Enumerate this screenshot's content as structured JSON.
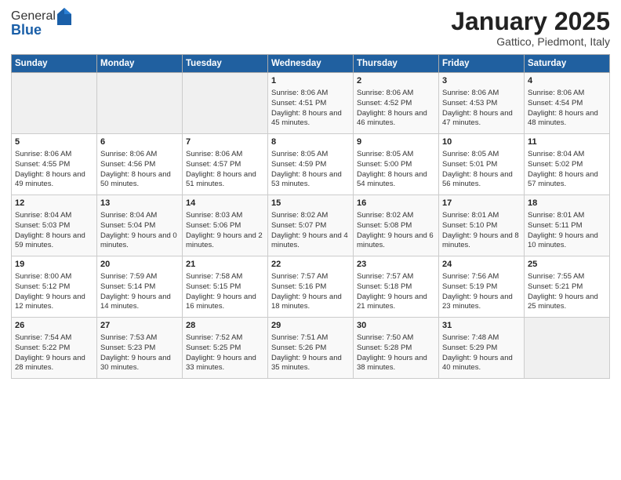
{
  "header": {
    "logo_general": "General",
    "logo_blue": "Blue",
    "title": "January 2025",
    "subtitle": "Gattico, Piedmont, Italy"
  },
  "days_of_week": [
    "Sunday",
    "Monday",
    "Tuesday",
    "Wednesday",
    "Thursday",
    "Friday",
    "Saturday"
  ],
  "weeks": [
    [
      {
        "day": "",
        "sunrise": "",
        "sunset": "",
        "daylight": ""
      },
      {
        "day": "",
        "sunrise": "",
        "sunset": "",
        "daylight": ""
      },
      {
        "day": "",
        "sunrise": "",
        "sunset": "",
        "daylight": ""
      },
      {
        "day": "1",
        "sunrise": "Sunrise: 8:06 AM",
        "sunset": "Sunset: 4:51 PM",
        "daylight": "Daylight: 8 hours and 45 minutes."
      },
      {
        "day": "2",
        "sunrise": "Sunrise: 8:06 AM",
        "sunset": "Sunset: 4:52 PM",
        "daylight": "Daylight: 8 hours and 46 minutes."
      },
      {
        "day": "3",
        "sunrise": "Sunrise: 8:06 AM",
        "sunset": "Sunset: 4:53 PM",
        "daylight": "Daylight: 8 hours and 47 minutes."
      },
      {
        "day": "4",
        "sunrise": "Sunrise: 8:06 AM",
        "sunset": "Sunset: 4:54 PM",
        "daylight": "Daylight: 8 hours and 48 minutes."
      }
    ],
    [
      {
        "day": "5",
        "sunrise": "Sunrise: 8:06 AM",
        "sunset": "Sunset: 4:55 PM",
        "daylight": "Daylight: 8 hours and 49 minutes."
      },
      {
        "day": "6",
        "sunrise": "Sunrise: 8:06 AM",
        "sunset": "Sunset: 4:56 PM",
        "daylight": "Daylight: 8 hours and 50 minutes."
      },
      {
        "day": "7",
        "sunrise": "Sunrise: 8:06 AM",
        "sunset": "Sunset: 4:57 PM",
        "daylight": "Daylight: 8 hours and 51 minutes."
      },
      {
        "day": "8",
        "sunrise": "Sunrise: 8:05 AM",
        "sunset": "Sunset: 4:59 PM",
        "daylight": "Daylight: 8 hours and 53 minutes."
      },
      {
        "day": "9",
        "sunrise": "Sunrise: 8:05 AM",
        "sunset": "Sunset: 5:00 PM",
        "daylight": "Daylight: 8 hours and 54 minutes."
      },
      {
        "day": "10",
        "sunrise": "Sunrise: 8:05 AM",
        "sunset": "Sunset: 5:01 PM",
        "daylight": "Daylight: 8 hours and 56 minutes."
      },
      {
        "day": "11",
        "sunrise": "Sunrise: 8:04 AM",
        "sunset": "Sunset: 5:02 PM",
        "daylight": "Daylight: 8 hours and 57 minutes."
      }
    ],
    [
      {
        "day": "12",
        "sunrise": "Sunrise: 8:04 AM",
        "sunset": "Sunset: 5:03 PM",
        "daylight": "Daylight: 8 hours and 59 minutes."
      },
      {
        "day": "13",
        "sunrise": "Sunrise: 8:04 AM",
        "sunset": "Sunset: 5:04 PM",
        "daylight": "Daylight: 9 hours and 0 minutes."
      },
      {
        "day": "14",
        "sunrise": "Sunrise: 8:03 AM",
        "sunset": "Sunset: 5:06 PM",
        "daylight": "Daylight: 9 hours and 2 minutes."
      },
      {
        "day": "15",
        "sunrise": "Sunrise: 8:02 AM",
        "sunset": "Sunset: 5:07 PM",
        "daylight": "Daylight: 9 hours and 4 minutes."
      },
      {
        "day": "16",
        "sunrise": "Sunrise: 8:02 AM",
        "sunset": "Sunset: 5:08 PM",
        "daylight": "Daylight: 9 hours and 6 minutes."
      },
      {
        "day": "17",
        "sunrise": "Sunrise: 8:01 AM",
        "sunset": "Sunset: 5:10 PM",
        "daylight": "Daylight: 9 hours and 8 minutes."
      },
      {
        "day": "18",
        "sunrise": "Sunrise: 8:01 AM",
        "sunset": "Sunset: 5:11 PM",
        "daylight": "Daylight: 9 hours and 10 minutes."
      }
    ],
    [
      {
        "day": "19",
        "sunrise": "Sunrise: 8:00 AM",
        "sunset": "Sunset: 5:12 PM",
        "daylight": "Daylight: 9 hours and 12 minutes."
      },
      {
        "day": "20",
        "sunrise": "Sunrise: 7:59 AM",
        "sunset": "Sunset: 5:14 PM",
        "daylight": "Daylight: 9 hours and 14 minutes."
      },
      {
        "day": "21",
        "sunrise": "Sunrise: 7:58 AM",
        "sunset": "Sunset: 5:15 PM",
        "daylight": "Daylight: 9 hours and 16 minutes."
      },
      {
        "day": "22",
        "sunrise": "Sunrise: 7:57 AM",
        "sunset": "Sunset: 5:16 PM",
        "daylight": "Daylight: 9 hours and 18 minutes."
      },
      {
        "day": "23",
        "sunrise": "Sunrise: 7:57 AM",
        "sunset": "Sunset: 5:18 PM",
        "daylight": "Daylight: 9 hours and 21 minutes."
      },
      {
        "day": "24",
        "sunrise": "Sunrise: 7:56 AM",
        "sunset": "Sunset: 5:19 PM",
        "daylight": "Daylight: 9 hours and 23 minutes."
      },
      {
        "day": "25",
        "sunrise": "Sunrise: 7:55 AM",
        "sunset": "Sunset: 5:21 PM",
        "daylight": "Daylight: 9 hours and 25 minutes."
      }
    ],
    [
      {
        "day": "26",
        "sunrise": "Sunrise: 7:54 AM",
        "sunset": "Sunset: 5:22 PM",
        "daylight": "Daylight: 9 hours and 28 minutes."
      },
      {
        "day": "27",
        "sunrise": "Sunrise: 7:53 AM",
        "sunset": "Sunset: 5:23 PM",
        "daylight": "Daylight: 9 hours and 30 minutes."
      },
      {
        "day": "28",
        "sunrise": "Sunrise: 7:52 AM",
        "sunset": "Sunset: 5:25 PM",
        "daylight": "Daylight: 9 hours and 33 minutes."
      },
      {
        "day": "29",
        "sunrise": "Sunrise: 7:51 AM",
        "sunset": "Sunset: 5:26 PM",
        "daylight": "Daylight: 9 hours and 35 minutes."
      },
      {
        "day": "30",
        "sunrise": "Sunrise: 7:50 AM",
        "sunset": "Sunset: 5:28 PM",
        "daylight": "Daylight: 9 hours and 38 minutes."
      },
      {
        "day": "31",
        "sunrise": "Sunrise: 7:48 AM",
        "sunset": "Sunset: 5:29 PM",
        "daylight": "Daylight: 9 hours and 40 minutes."
      },
      {
        "day": "",
        "sunrise": "",
        "sunset": "",
        "daylight": ""
      }
    ]
  ]
}
